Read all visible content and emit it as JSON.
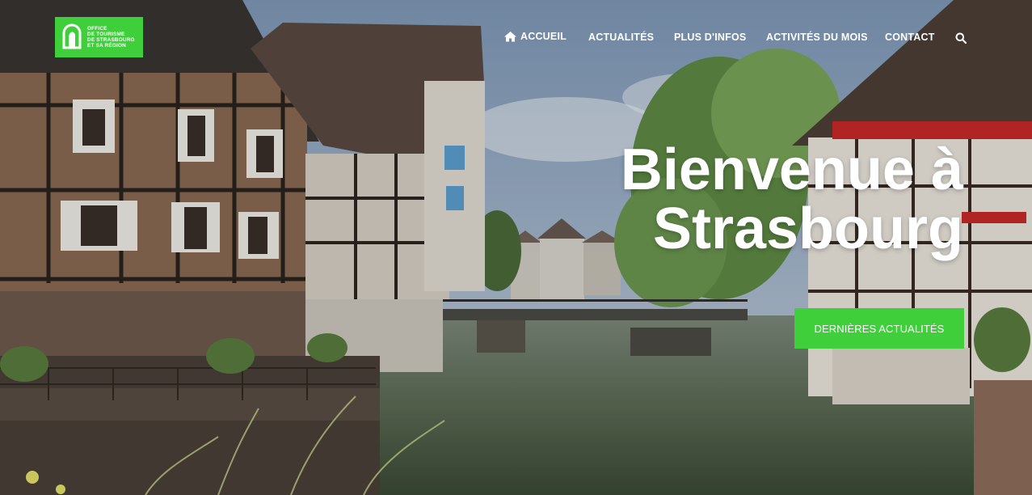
{
  "logo": {
    "alt_name": "office-de-tourisme-logo",
    "lines": [
      "OFFICE",
      "DE TOURISME",
      "DE STRASBOURG",
      "ET SA RÉGION"
    ]
  },
  "nav": {
    "items": [
      {
        "label": "ACCUEIL",
        "icon": "home-icon"
      },
      {
        "label": "ACTUALITÉS"
      },
      {
        "label": "PLUS D'INFOS"
      },
      {
        "label": "ACTIVITÉS DU MOIS"
      },
      {
        "label": "CONTACT"
      }
    ],
    "search_icon": "search-icon"
  },
  "hero": {
    "title_line1": "Bienvenue à",
    "title_line2": "Strasbourg",
    "cta_label": "DERNIÈRES ACTUALITÉS"
  },
  "colors": {
    "brand_green": "#3ecf3a",
    "text": "#ffffff"
  }
}
